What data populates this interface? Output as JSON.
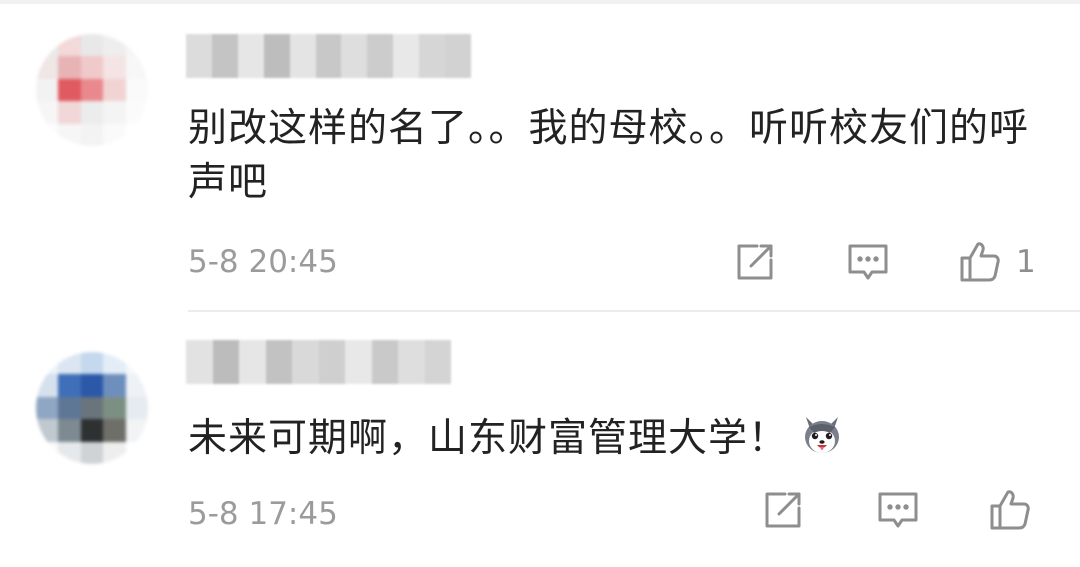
{
  "comments": [
    {
      "content": "别改这样的名了。。我的母校。。听听校友们的呼声吧",
      "time": "5-8 20:45",
      "like_count": "1",
      "avatar_colors": [
        "#eaeaea",
        "#f3d9d9",
        "#e8e8e8",
        "#eeeeee",
        "#f6f6f6",
        "#efe6e6",
        "#e7b3b5",
        "#f0c9ca",
        "#f4e4e4",
        "#f7f7f7",
        "#f2f2f2",
        "#e05a61",
        "#e9898d",
        "#f2d3d4",
        "#fafafa",
        "#f6f6f6",
        "#f1d7d8",
        "#ececec",
        "#f4f4f4",
        "#fbfbfb",
        "#fcfcfc",
        "#f6f6f6",
        "#f3f3f3",
        "#fafafa",
        "#ffffff"
      ],
      "username_colors": [
        "#dcdcdc",
        "#c4c4c4",
        "#e6e6e6",
        "#bdbdbd",
        "#e4e4e4",
        "#c8c8c8",
        "#dedede",
        "#cccccc",
        "#e8e8e8",
        "#d6d6d6",
        "#d2d2d2"
      ]
    },
    {
      "content": "未来可期啊，山东财富管理大学！",
      "time": "5-8 17:45",
      "like_count": "",
      "avatar_colors": [
        "#eef3f8",
        "#dbe6f2",
        "#c5d8ee",
        "#e3edf7",
        "#f5f8fb",
        "#d6e1ee",
        "#3f6fb8",
        "#2b58a8",
        "#6e8fbe",
        "#eef2f7",
        "#8fa7c3",
        "#5d7795",
        "#6a747d",
        "#7c8f83",
        "#e5ebf1",
        "#c0c8d0",
        "#7d8a91",
        "#2e3132",
        "#6f6f69",
        "#f1f3f5",
        "#f8f9fa",
        "#e6e9ec",
        "#cfd3d6",
        "#eeeeee",
        "#ffffff"
      ],
      "username_colors": [
        "#e2e2e2",
        "#bcbcbc",
        "#e6e6e6",
        "#c2c2c2",
        "#d9d9d9",
        "#cfcfcf",
        "#e8e8e8",
        "#c9c9c9",
        "#dedede",
        "#d4d4d4"
      ]
    }
  ],
  "icons": {
    "share": "share-icon",
    "reply": "reply-icon",
    "like": "thumbs-up-icon",
    "emoji": "husky-dog-emoji"
  },
  "colors": {
    "text": "#222222",
    "meta": "#9b9b9b",
    "icon": "#8e8e8e"
  }
}
